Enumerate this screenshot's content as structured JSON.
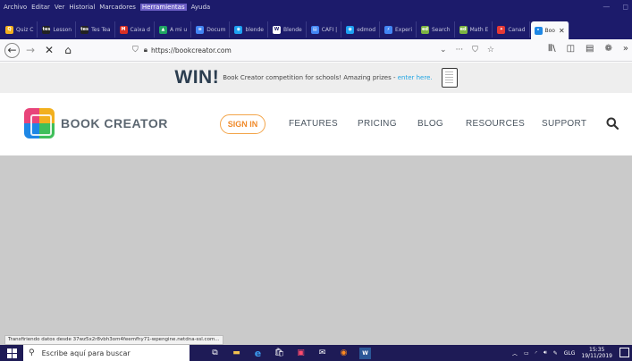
{
  "menu": {
    "items": [
      "Archivo",
      "Editar",
      "Ver",
      "Historial",
      "Marcadores",
      "Herramientas",
      "Ayuda"
    ],
    "active_index": 5
  },
  "tabs": [
    {
      "label": "Quiz C",
      "fav_color": "#f2b01e",
      "fav_text": "Q"
    },
    {
      "label": "Lesson",
      "fav_color": "#222222",
      "fav_text": "tes"
    },
    {
      "label": "Tes Tea",
      "fav_color": "#222222",
      "fav_text": "tes"
    },
    {
      "label": "Caixa d",
      "fav_color": "#d93025",
      "fav_text": "M"
    },
    {
      "label": "A mi u",
      "fav_color": "#1fa463",
      "fav_text": "▲"
    },
    {
      "label": "Docum",
      "fav_color": "#4285f4",
      "fav_text": "≡"
    },
    {
      "label": "blende",
      "fav_color": "#1da1f2",
      "fav_text": "◉"
    },
    {
      "label": "Blende",
      "fav_color": "#ffffff",
      "fav_text": "W"
    },
    {
      "label": "CAFI |",
      "fav_color": "#4285f4",
      "fav_text": "▤"
    },
    {
      "label": "edmod",
      "fav_color": "#1da1f2",
      "fav_text": "◉"
    },
    {
      "label": "Experi",
      "fav_color": "#4285f4",
      "fav_text": "⚡"
    },
    {
      "label": "Search",
      "fav_color": "#7cb342",
      "fav_text": "ed"
    },
    {
      "label": "Math E",
      "fav_color": "#7cb342",
      "fav_text": "ed"
    },
    {
      "label": "Canad",
      "fav_color": "#e53935",
      "fav_text": "✦"
    },
    {
      "label": "Boo",
      "fav_color": "#1e87e5",
      "fav_text": "•",
      "active": true
    }
  ],
  "nav": {
    "url": "https://bookcreator.com"
  },
  "banner": {
    "win": "WIN!",
    "text": "Book Creator competition for schools! Amazing prizes - ",
    "link": "enter here."
  },
  "site": {
    "brand": "BOOK CREATOR",
    "sign_in": "SIGN IN",
    "links": [
      "FEATURES",
      "PRICING",
      "BLOG",
      "RESOURCES",
      "SUPPORT"
    ]
  },
  "status": "Transfiriendo datos desde 37wz5x2r8vbh3om4feemfhy71-wpengine.netdna-ssl.com...",
  "taskbar": {
    "search_placeholder": "Escribe aquí para buscar",
    "lang": "GLG",
    "time": "15:35",
    "date": "19/11/2019"
  },
  "colors": {
    "browser_chrome": "#1c1b6b",
    "accent_orange": "#f08a2a",
    "link_blue": "#23a6e3",
    "content_gray": "#cacaca"
  }
}
